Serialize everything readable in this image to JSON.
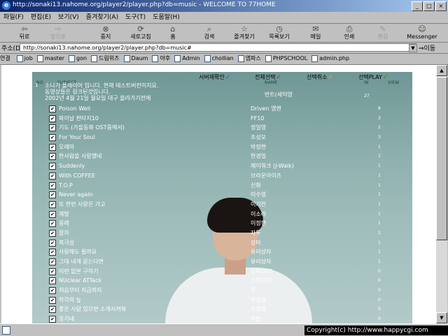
{
  "window": {
    "title": "http://sonaki13.nahome.org/player2/player.php?db=music - WELCOME TO 77HOME",
    "app_icon": "e",
    "buttons": [
      {
        "name": "minimize-button",
        "glyph": "_"
      },
      {
        "name": "maximize-button",
        "glyph": "□"
      },
      {
        "name": "close-button",
        "glyph": "×"
      }
    ]
  },
  "menu": [
    "파일(F)",
    "편집(E)",
    "보기(V)",
    "즐겨찾기(A)",
    "도구(T)",
    "도움말(H)"
  ],
  "toolbar": {
    "buttons": [
      {
        "label": "뒤로",
        "icon": "back-arrow-icon",
        "glyph": "⇦",
        "disabled": false
      },
      {
        "label": "앞으로",
        "icon": "forward-arrow-icon",
        "glyph": "⇨",
        "disabled": true
      },
      {
        "label": "중지",
        "icon": "stop-icon",
        "glyph": "⊗",
        "disabled": false
      },
      {
        "label": "새로고침",
        "icon": "refresh-icon",
        "glyph": "⟳",
        "disabled": false
      },
      {
        "label": "홈",
        "icon": "home-icon",
        "glyph": "⌂",
        "disabled": false
      },
      {
        "label": "검색",
        "icon": "search-icon",
        "glyph": "⌕",
        "disabled": false
      },
      {
        "label": "즐겨찾기",
        "icon": "favorites-icon",
        "glyph": "☆",
        "disabled": false
      },
      {
        "label": "목록보기",
        "icon": "history-icon",
        "glyph": "◷",
        "disabled": false
      },
      {
        "label": "메일",
        "icon": "mail-icon",
        "glyph": "✉",
        "disabled": false
      },
      {
        "label": "인쇄",
        "icon": "print-icon",
        "glyph": "⎙",
        "disabled": false
      },
      {
        "label": "편집",
        "icon": "edit-icon",
        "glyph": "✎",
        "disabled": true
      },
      {
        "label": "Messenger",
        "icon": "messenger-icon",
        "glyph": "☺",
        "disabled": false
      }
    ]
  },
  "address": {
    "label": "주소(D)",
    "url": "http://sonaki13.nahome.org/player2/player.php?db=music#",
    "go_label": "⇒이동"
  },
  "links": {
    "label": "연결",
    "items": [
      "job",
      "master",
      "gon",
      "드림위즈",
      "Daum",
      "야후",
      "Admin",
      "chollian",
      "엠파스",
      "PHPSCHOOL",
      "admin.php"
    ]
  },
  "player": {
    "actions": {
      "server_check": "서버재확인",
      "select_all": "전체선택",
      "deselect": "선택취소",
      "play_selected": "선택PLAY"
    },
    "columns": {
      "no": "NO",
      "subject": "SUBJECT",
      "name": "NAME",
      "in": "IN",
      "view": "VIEW"
    },
    "notice": {
      "number": "1",
      "line1": "소나기 플레이어 입니다. 현재 테스트버전이지요.",
      "line2": "동영상들은 링크된것입니다.",
      "line3": "2002년 4월 21일 월요일 대구 올라가기전에",
      "author": "반트(세익영",
      "count": "27"
    },
    "songs": [
      {
        "title": "Poison Well",
        "artist": "Driven 엠앤",
        "view": "8"
      },
      {
        "title": "파이날 판타지10",
        "artist": "FF10",
        "view": "3"
      },
      {
        "title": "기도 (가을동화 OST중에서)",
        "artist": "정일영",
        "view": "2"
      },
      {
        "title": "For Your Soul",
        "artist": "조성모",
        "view": "3"
      },
      {
        "title": "오레마",
        "artist": "박정현",
        "view": "1"
      },
      {
        "title": "한사람을 사랑했네",
        "artist": "한경일",
        "view": "1"
      },
      {
        "title": "Suddenly",
        "artist": "제이워크 (J-Walk)",
        "view": "1"
      },
      {
        "title": "With COFFEE",
        "artist": "브라운아이즈",
        "view": "1"
      },
      {
        "title": "T.O.P",
        "artist": "신화",
        "view": "1"
      },
      {
        "title": "Never again",
        "artist": "이수영",
        "view": "1"
      },
      {
        "title": "또 한번 사랑은 가고",
        "artist": "이기찬",
        "view": "1"
      },
      {
        "title": "재발",
        "artist": "이소라",
        "view": "1"
      },
      {
        "title": "몽래",
        "artist": "이정현",
        "view": "1"
      },
      {
        "title": "칼차",
        "artist": "자두",
        "view": "2"
      },
      {
        "title": "복극성",
        "artist": "강타",
        "view": "1"
      },
      {
        "title": "사랑해도 될까요",
        "artist": "유리상자",
        "view": "1"
      },
      {
        "title": "그대 내게 묻는다면",
        "artist": "유리상자",
        "view": "1"
      },
      {
        "title": "미련 없본 구하기",
        "artist": "스타GST",
        "view": "0"
      },
      {
        "title": "NUclear ATTack",
        "artist": "스타GST",
        "view": "0"
      },
      {
        "title": "처음부터 지금까지",
        "artist": "류",
        "view": "0"
      },
      {
        "title": "착각의 늪",
        "artist": "박경림",
        "view": "0"
      },
      {
        "title": "좋은 사람 있으면 소개시켜줘",
        "artist": "조호영",
        "view": "0"
      },
      {
        "title": "옷기네",
        "artist": "하늘",
        "view": "0"
      }
    ]
  },
  "status": {
    "copyright": "Copyright(c) http://www.happycgi.com"
  },
  "colors": {
    "title_gradient_start": "#0a246a",
    "title_gradient_end": "#a6caf0",
    "panel_bg": "#8fb1af",
    "check_blue": "#1a5ed4",
    "check_red": "#d01818",
    "check_yellow": "#d8c400",
    "check_green": "#10a010"
  }
}
